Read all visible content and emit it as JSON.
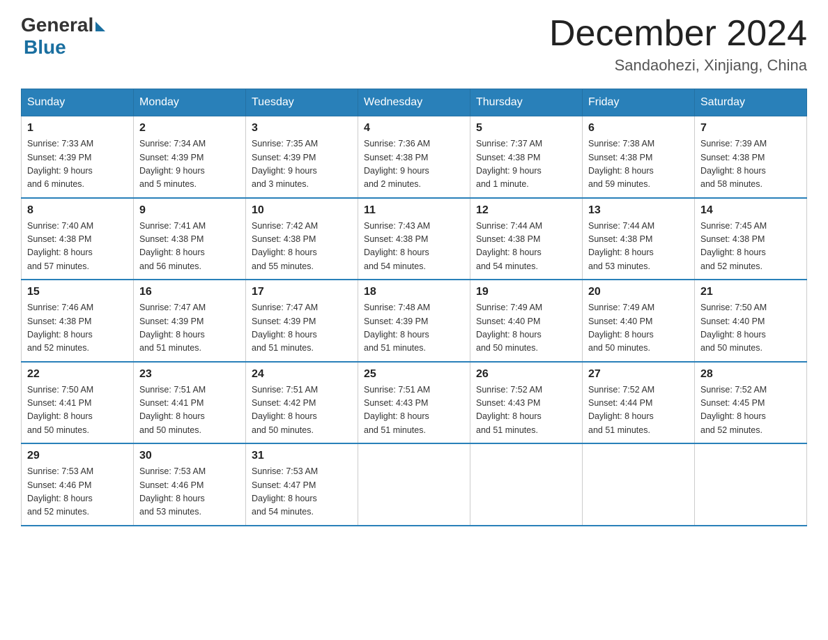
{
  "header": {
    "logo_general": "General",
    "logo_blue": "Blue",
    "month_year": "December 2024",
    "location": "Sandaohezi, Xinjiang, China"
  },
  "weekdays": [
    "Sunday",
    "Monday",
    "Tuesday",
    "Wednesday",
    "Thursday",
    "Friday",
    "Saturday"
  ],
  "weeks": [
    [
      {
        "day": "1",
        "sunrise": "7:33 AM",
        "sunset": "4:39 PM",
        "daylight": "9 hours and 6 minutes."
      },
      {
        "day": "2",
        "sunrise": "7:34 AM",
        "sunset": "4:39 PM",
        "daylight": "9 hours and 5 minutes."
      },
      {
        "day": "3",
        "sunrise": "7:35 AM",
        "sunset": "4:39 PM",
        "daylight": "9 hours and 3 minutes."
      },
      {
        "day": "4",
        "sunrise": "7:36 AM",
        "sunset": "4:38 PM",
        "daylight": "9 hours and 2 minutes."
      },
      {
        "day": "5",
        "sunrise": "7:37 AM",
        "sunset": "4:38 PM",
        "daylight": "9 hours and 1 minute."
      },
      {
        "day": "6",
        "sunrise": "7:38 AM",
        "sunset": "4:38 PM",
        "daylight": "8 hours and 59 minutes."
      },
      {
        "day": "7",
        "sunrise": "7:39 AM",
        "sunset": "4:38 PM",
        "daylight": "8 hours and 58 minutes."
      }
    ],
    [
      {
        "day": "8",
        "sunrise": "7:40 AM",
        "sunset": "4:38 PM",
        "daylight": "8 hours and 57 minutes."
      },
      {
        "day": "9",
        "sunrise": "7:41 AM",
        "sunset": "4:38 PM",
        "daylight": "8 hours and 56 minutes."
      },
      {
        "day": "10",
        "sunrise": "7:42 AM",
        "sunset": "4:38 PM",
        "daylight": "8 hours and 55 minutes."
      },
      {
        "day": "11",
        "sunrise": "7:43 AM",
        "sunset": "4:38 PM",
        "daylight": "8 hours and 54 minutes."
      },
      {
        "day": "12",
        "sunrise": "7:44 AM",
        "sunset": "4:38 PM",
        "daylight": "8 hours and 54 minutes."
      },
      {
        "day": "13",
        "sunrise": "7:44 AM",
        "sunset": "4:38 PM",
        "daylight": "8 hours and 53 minutes."
      },
      {
        "day": "14",
        "sunrise": "7:45 AM",
        "sunset": "4:38 PM",
        "daylight": "8 hours and 52 minutes."
      }
    ],
    [
      {
        "day": "15",
        "sunrise": "7:46 AM",
        "sunset": "4:38 PM",
        "daylight": "8 hours and 52 minutes."
      },
      {
        "day": "16",
        "sunrise": "7:47 AM",
        "sunset": "4:39 PM",
        "daylight": "8 hours and 51 minutes."
      },
      {
        "day": "17",
        "sunrise": "7:47 AM",
        "sunset": "4:39 PM",
        "daylight": "8 hours and 51 minutes."
      },
      {
        "day": "18",
        "sunrise": "7:48 AM",
        "sunset": "4:39 PM",
        "daylight": "8 hours and 51 minutes."
      },
      {
        "day": "19",
        "sunrise": "7:49 AM",
        "sunset": "4:40 PM",
        "daylight": "8 hours and 50 minutes."
      },
      {
        "day": "20",
        "sunrise": "7:49 AM",
        "sunset": "4:40 PM",
        "daylight": "8 hours and 50 minutes."
      },
      {
        "day": "21",
        "sunrise": "7:50 AM",
        "sunset": "4:40 PM",
        "daylight": "8 hours and 50 minutes."
      }
    ],
    [
      {
        "day": "22",
        "sunrise": "7:50 AM",
        "sunset": "4:41 PM",
        "daylight": "8 hours and 50 minutes."
      },
      {
        "day": "23",
        "sunrise": "7:51 AM",
        "sunset": "4:41 PM",
        "daylight": "8 hours and 50 minutes."
      },
      {
        "day": "24",
        "sunrise": "7:51 AM",
        "sunset": "4:42 PM",
        "daylight": "8 hours and 50 minutes."
      },
      {
        "day": "25",
        "sunrise": "7:51 AM",
        "sunset": "4:43 PM",
        "daylight": "8 hours and 51 minutes."
      },
      {
        "day": "26",
        "sunrise": "7:52 AM",
        "sunset": "4:43 PM",
        "daylight": "8 hours and 51 minutes."
      },
      {
        "day": "27",
        "sunrise": "7:52 AM",
        "sunset": "4:44 PM",
        "daylight": "8 hours and 51 minutes."
      },
      {
        "day": "28",
        "sunrise": "7:52 AM",
        "sunset": "4:45 PM",
        "daylight": "8 hours and 52 minutes."
      }
    ],
    [
      {
        "day": "29",
        "sunrise": "7:53 AM",
        "sunset": "4:46 PM",
        "daylight": "8 hours and 52 minutes."
      },
      {
        "day": "30",
        "sunrise": "7:53 AM",
        "sunset": "4:46 PM",
        "daylight": "8 hours and 53 minutes."
      },
      {
        "day": "31",
        "sunrise": "7:53 AM",
        "sunset": "4:47 PM",
        "daylight": "8 hours and 54 minutes."
      },
      null,
      null,
      null,
      null
    ]
  ],
  "labels": {
    "sunrise": "Sunrise:",
    "sunset": "Sunset:",
    "daylight": "Daylight:"
  }
}
